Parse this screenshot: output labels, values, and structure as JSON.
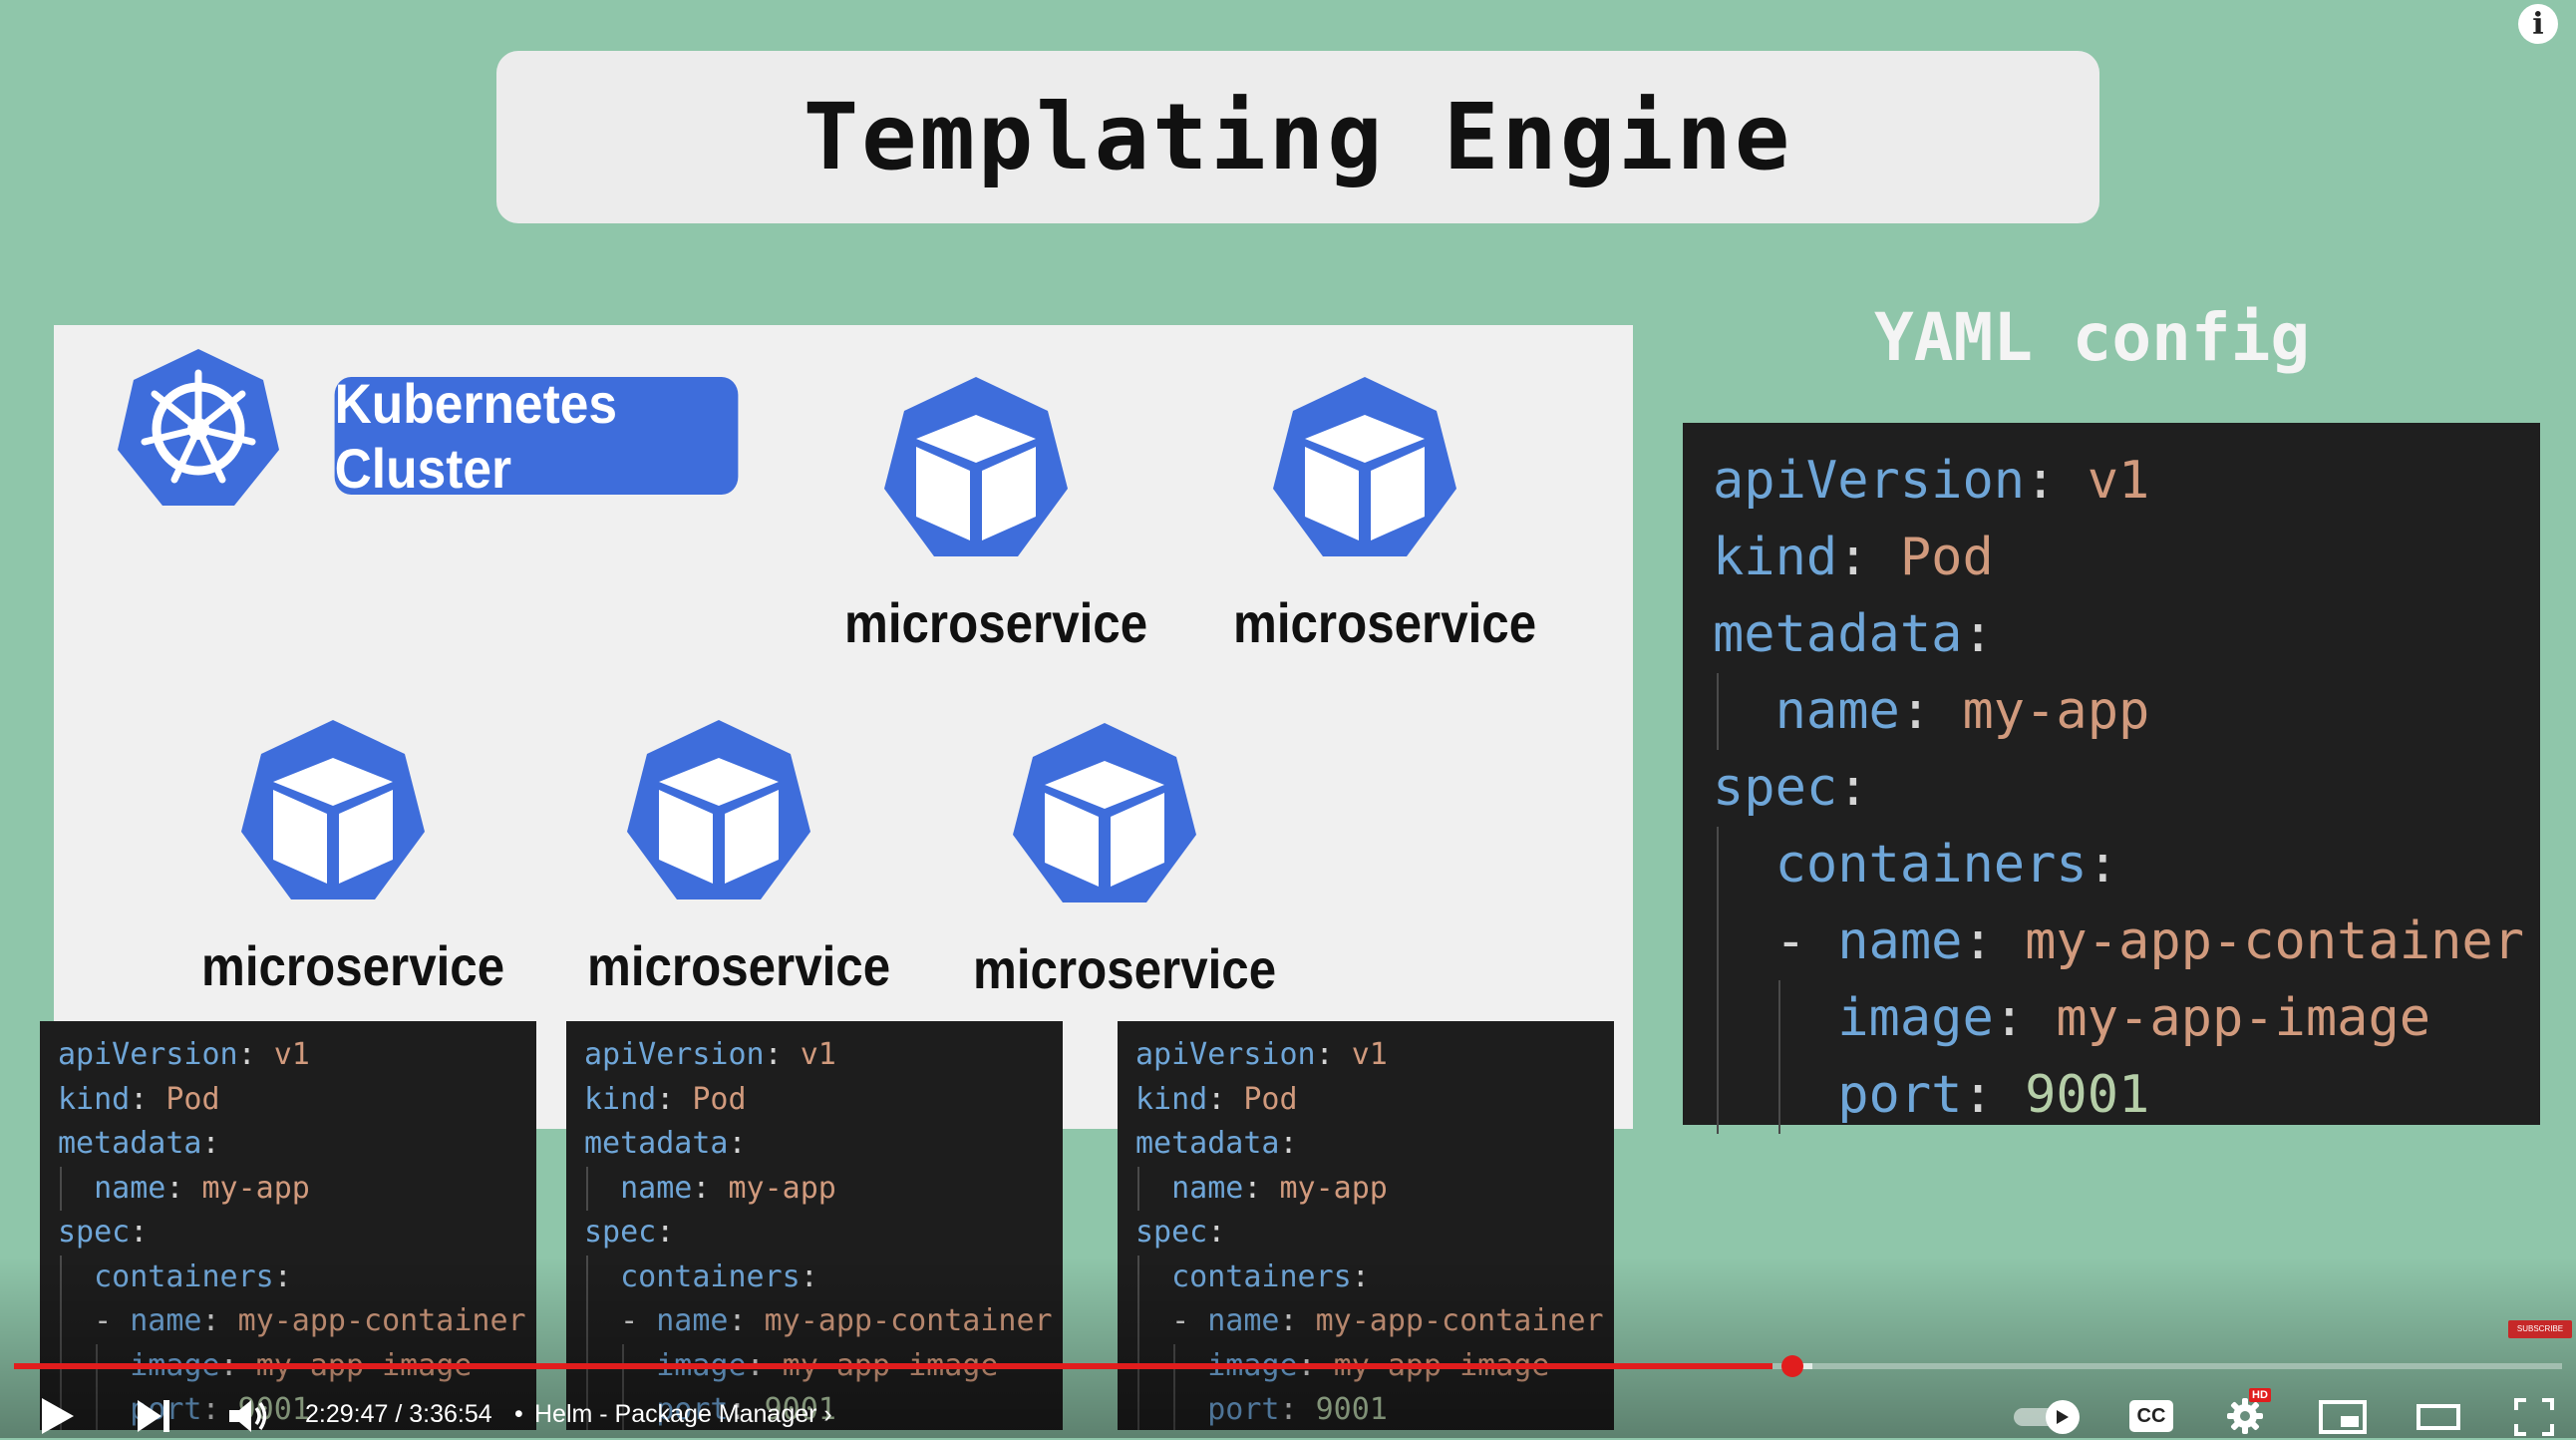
{
  "slide": {
    "title": "Templating Engine",
    "cluster_label": "Kubernetes Cluster",
    "microservice_label": "microservice",
    "yaml_heading": "YAML config"
  },
  "yaml": {
    "apiVersion_key": "apiVersion",
    "apiVersion_val": "v1",
    "kind_key": "kind",
    "kind_val": "Pod",
    "metadata_key": "metadata",
    "name_key": "name",
    "name_val": "my-app",
    "spec_key": "spec",
    "containers_key": "containers",
    "container_name_val": "my-app-container",
    "image_key": "image",
    "image_val": "my-app-image",
    "port_key": "port",
    "port_val": "9001"
  },
  "player": {
    "time": "2:29:47 / 3:36:54",
    "separator": "•",
    "chapter": "Helm - Package Manager",
    "info_icon": "i",
    "cc_label": "CC",
    "hd_badge": "HD",
    "subscribe_label": "SUBSCRIBE",
    "progress_fraction": 0.69
  },
  "colors": {
    "background": "#8fc6aa",
    "k8s_blue": "#3e6ddb",
    "progress_red": "#e11d1d"
  }
}
